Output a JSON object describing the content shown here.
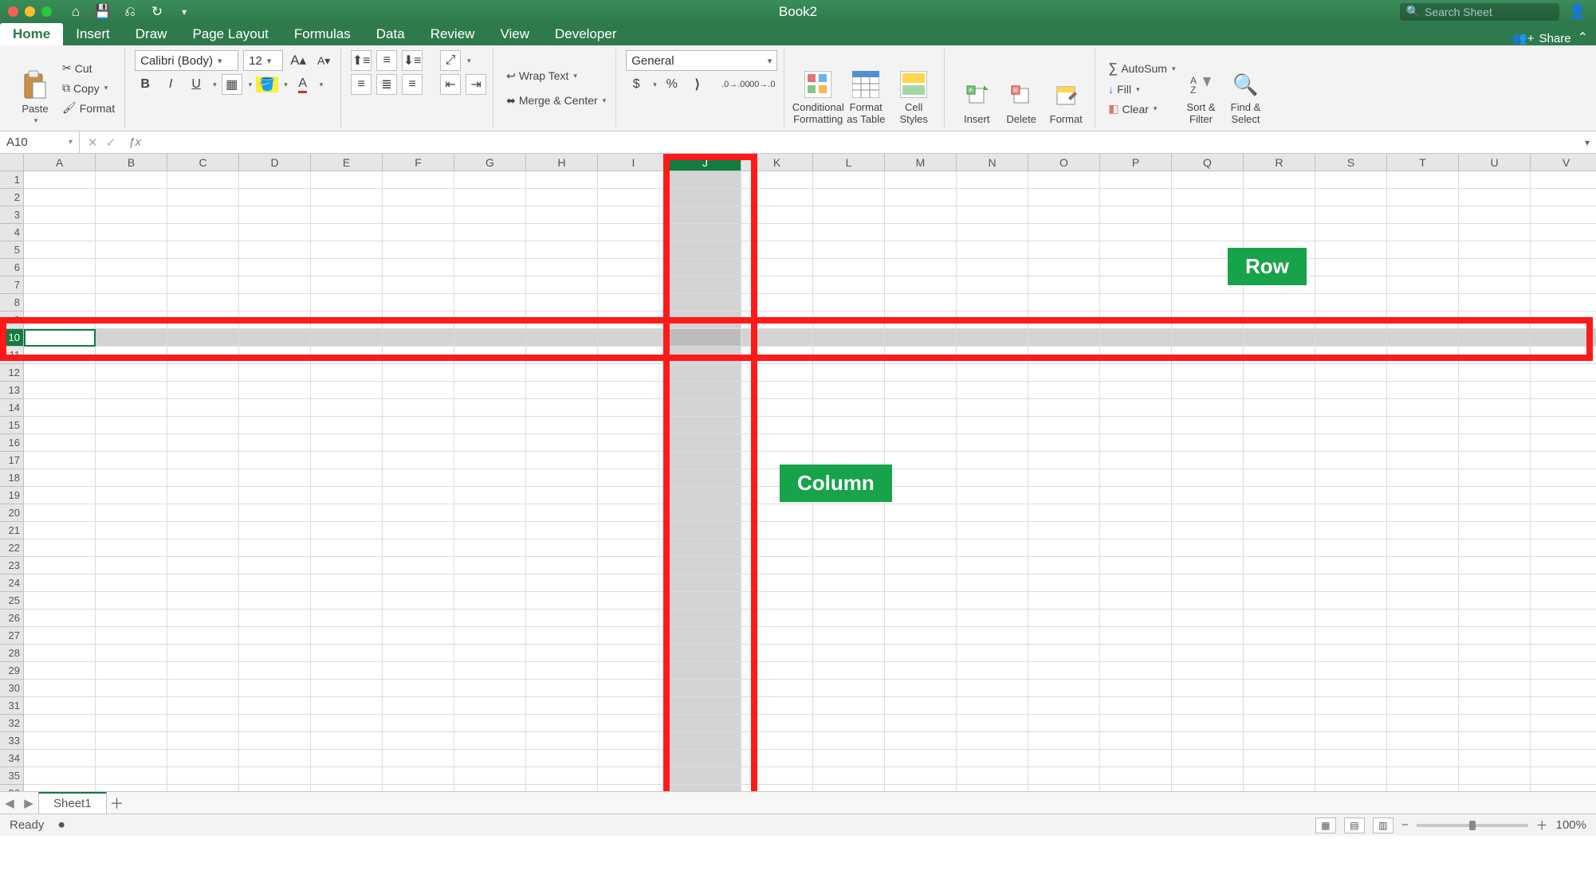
{
  "title": "Book2",
  "search_placeholder": "Search Sheet",
  "tabs": [
    "Home",
    "Insert",
    "Draw",
    "Page Layout",
    "Formulas",
    "Data",
    "Review",
    "View",
    "Developer"
  ],
  "active_tab": "Home",
  "share_label": "Share",
  "clipboard": {
    "paste": "Paste",
    "cut": "Cut",
    "copy": "Copy",
    "format": "Format"
  },
  "font": {
    "name": "Calibri (Body)",
    "size": "12",
    "increase": "A",
    "decrease": "A",
    "bold": "B",
    "italic": "I",
    "underline": "U"
  },
  "alignment": {
    "wrap": "Wrap Text",
    "merge": "Merge & Center"
  },
  "number": {
    "format": "General",
    "currency": "$",
    "percent": "%",
    "comma": ",",
    "inc_dec_labels": [
      "Increase Decimal",
      "Decrease Decimal"
    ]
  },
  "styles": {
    "cond": "Conditional\nFormatting",
    "table": "Format\nas Table",
    "cell": "Cell\nStyles"
  },
  "cells": {
    "insert": "Insert",
    "delete": "Delete",
    "format": "Format"
  },
  "editing": {
    "autosum": "AutoSum",
    "fill": "Fill",
    "clear": "Clear",
    "sort": "Sort &\nFilter",
    "find": "Find &\nSelect"
  },
  "namebox": "A10",
  "columns": [
    "A",
    "B",
    "C",
    "D",
    "E",
    "F",
    "G",
    "H",
    "I",
    "J",
    "K",
    "L",
    "M",
    "N",
    "O",
    "P",
    "Q",
    "R",
    "S",
    "T",
    "U",
    "V"
  ],
  "rows_count": 36,
  "selected_column_index": 9,
  "selected_row_index": 9,
  "active_cell": {
    "col": 0,
    "row": 9
  },
  "annotations": {
    "row_label": "Row",
    "col_label": "Column"
  },
  "sheet_tab": "Sheet1",
  "status_text": "Ready",
  "zoom": "100%"
}
